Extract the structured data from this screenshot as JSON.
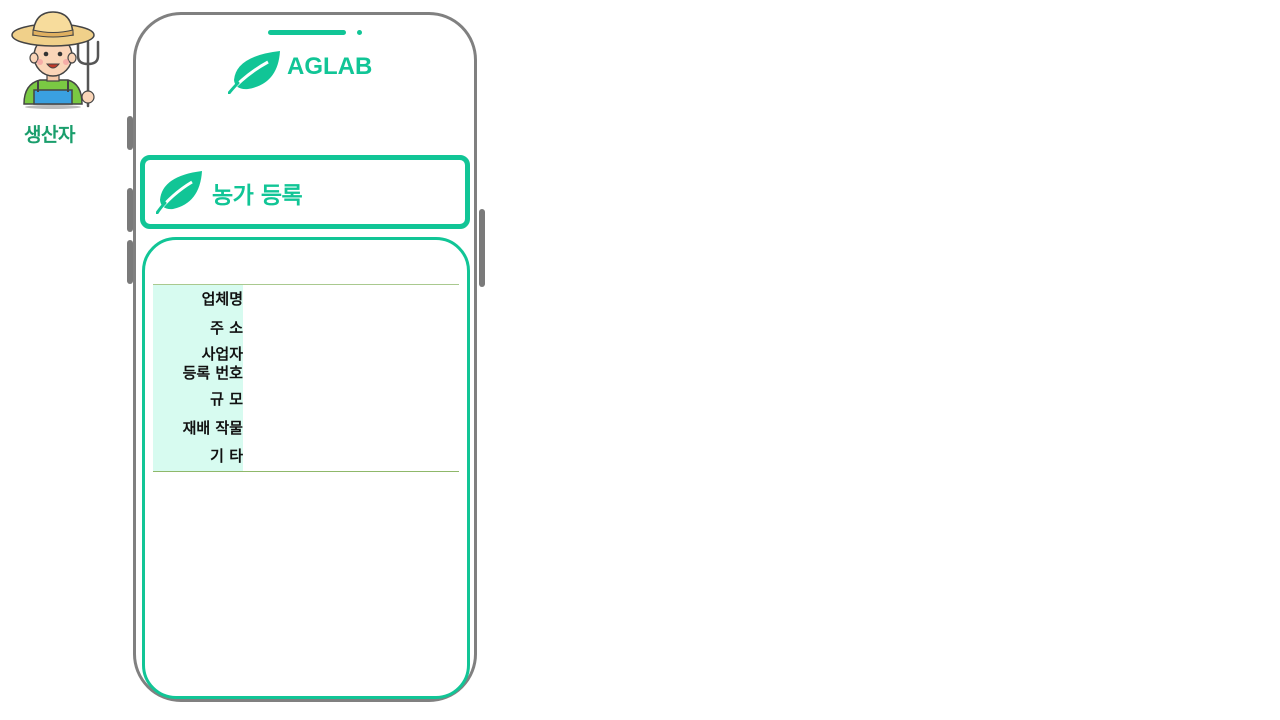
{
  "character": {
    "icon": "farmer-icon",
    "label": "생산자"
  },
  "app": {
    "brand_icon": "leaf-icon",
    "brand_name": "AGLAB",
    "accent_color": "#11c596"
  },
  "page": {
    "title_icon": "leaf-icon",
    "title": "농가 등록"
  },
  "form": {
    "fields": [
      {
        "label": "업체명",
        "value": ""
      },
      {
        "label": "주 소",
        "value": ""
      },
      {
        "label_line1": "사업자",
        "label_line2": "등록 번호",
        "value": ""
      },
      {
        "label": "규 모",
        "value": ""
      },
      {
        "label": "재배 작물",
        "value": ""
      },
      {
        "label": "기 타",
        "value": ""
      }
    ]
  }
}
